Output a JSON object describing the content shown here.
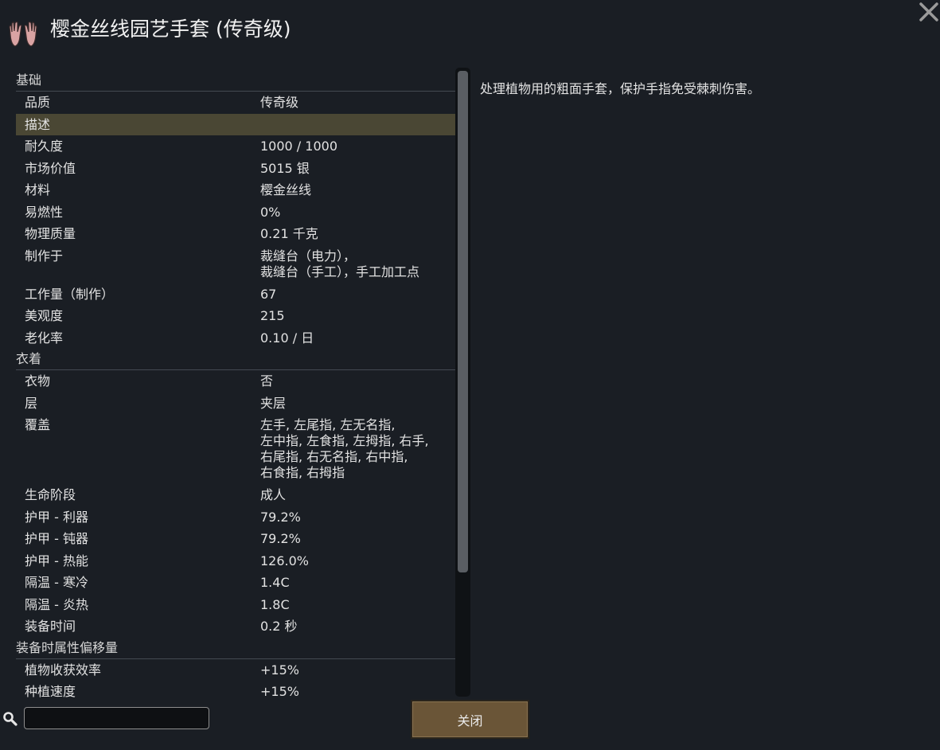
{
  "title": "樱金丝线园艺手套 (传奇级)",
  "description": "处理植物用的粗面手套，保护手指免受棘刺伤害。",
  "close_label": "关闭",
  "search": {
    "value": "",
    "placeholder": ""
  },
  "sections": {
    "basic": {
      "label": "基础",
      "rows": [
        {
          "label": "品质",
          "value": "传奇级"
        },
        {
          "label": "描述",
          "value": ""
        },
        {
          "label": "耐久度",
          "value": "1000 / 1000"
        },
        {
          "label": "市场价值",
          "value": "5015 银"
        },
        {
          "label": "材料",
          "value": "樱金丝线"
        },
        {
          "label": "易燃性",
          "value": "0%"
        },
        {
          "label": "物理质量",
          "value": "0.21 千克"
        },
        {
          "label": "制作于",
          "value": "裁缝台（电力），\n裁缝台（手工），手工加工点"
        },
        {
          "label": "工作量（制作）",
          "value": "67"
        },
        {
          "label": "美观度",
          "value": "215"
        },
        {
          "label": "老化率",
          "value": "0.10 / 日"
        }
      ]
    },
    "apparel": {
      "label": "衣着",
      "rows": [
        {
          "label": "衣物",
          "value": "否"
        },
        {
          "label": "层",
          "value": "夹层"
        },
        {
          "label": "覆盖",
          "value": "左手, 左尾指, 左无名指,\n左中指, 左食指, 左拇指, 右手,\n右尾指, 右无名指, 右中指,\n右食指, 右拇指"
        },
        {
          "label": "生命阶段",
          "value": "成人"
        },
        {
          "label": "护甲 - 利器",
          "value": "79.2%"
        },
        {
          "label": "护甲 - 钝器",
          "value": "79.2%"
        },
        {
          "label": "护甲 - 热能",
          "value": "126.0%"
        },
        {
          "label": "隔温 - 寒冷",
          "value": "1.4C"
        },
        {
          "label": "隔温 - 炎热",
          "value": "1.8C"
        },
        {
          "label": "装备时间",
          "value": "0.2 秒"
        }
      ]
    },
    "offsets": {
      "label": "装备时属性偏移量",
      "rows": [
        {
          "label": "植物收获效率",
          "value": "+15%"
        },
        {
          "label": "种植速度",
          "value": "+15%"
        }
      ]
    }
  }
}
